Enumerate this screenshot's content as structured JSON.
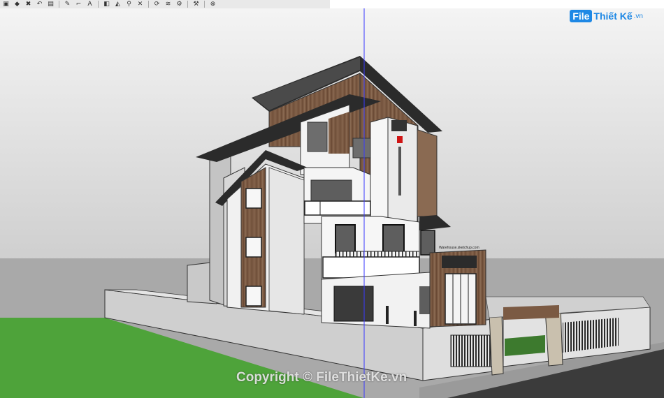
{
  "toolbar": {
    "icons": [
      "select-tool",
      "eraser",
      "paint-bucket",
      "move-tool",
      "rotate-tool",
      "pencil",
      "tape-measure",
      "text-tool",
      "paint",
      "zoom",
      "zoom-extents",
      "orbit",
      "pan",
      "walk",
      "look-around",
      "position-camera",
      "section-plane",
      "styles"
    ]
  },
  "logo": {
    "part1": "File",
    "part2": "Thiết Kế",
    "part3": ".vn"
  },
  "watermark": "Copyright © FileThietKe.vn",
  "sign_text": "Warehouse.sketchup.com",
  "colors": {
    "sky": "#dcdcdc",
    "grass": "#4ea33a",
    "wood": "#7b5a43",
    "roof": "#2e2e2e",
    "axis_blue": "#3a3aff",
    "logo_blue": "#1e88e5"
  }
}
